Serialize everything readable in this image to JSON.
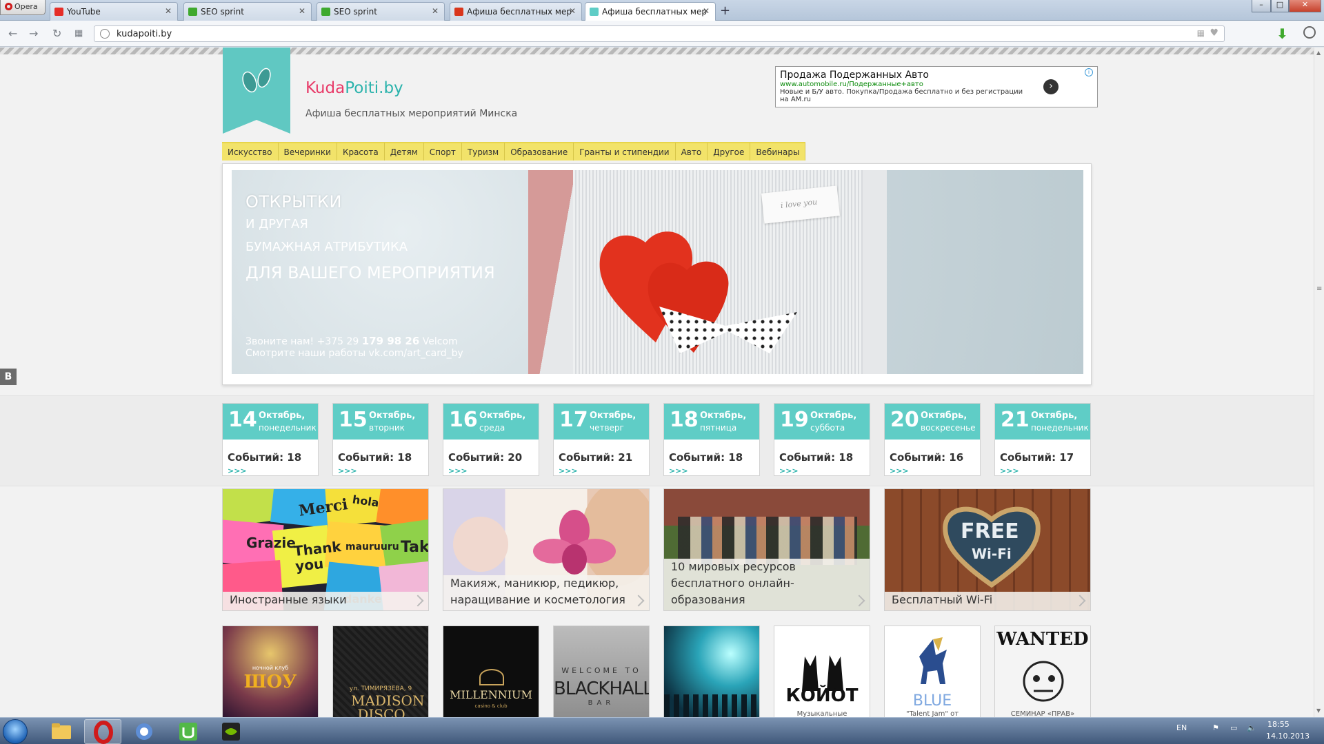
{
  "browser": {
    "menu_label": "Opera",
    "tabs": [
      {
        "title": "YouTube",
        "icon_color": "#e52d27"
      },
      {
        "title": "SEO sprint",
        "icon_color": "#3fa92e"
      },
      {
        "title": "SEO sprint",
        "icon_color": "#3fa92e"
      },
      {
        "title": "Афиша бесплатных мер",
        "icon_color": "#d9361c"
      },
      {
        "title": "Афиша бесплатных мер",
        "icon_color": "#5fcdc6"
      }
    ],
    "new_tab": "+",
    "url": "kudapoiti.by",
    "window_controls": {
      "minimize": "–",
      "maximize": "□",
      "close": "✕"
    }
  },
  "site": {
    "logo_part1": "Kuda",
    "logo_part2": "Poiti.by",
    "tagline": "Афиша бесплатных мероприятий Минска",
    "accent_color": "#5fcdc6",
    "nav_color": "#f2e36a"
  },
  "ad": {
    "title": "Продажа Подержанных Авто",
    "url": "www.automobile.ru/Подержанные+авто",
    "description": "Новые и Б/У авто. Покупка/Продажа бесплатно и без регистрации на AM.ru",
    "info_icon": "i"
  },
  "categories": [
    "Искусство",
    "Вечеринки",
    "Красота",
    "Детям",
    "Спорт",
    "Туризм",
    "Образование",
    "Гранты и стипендии",
    "Авто",
    "Другое",
    "Вебинары"
  ],
  "banner": {
    "line1": "ОТКРЫТКИ",
    "line2": "И ДРУГАЯ",
    "line3": "БУМАЖНАЯ АТРИБУТИКА",
    "line4": "ДЛЯ ВАШЕГО МЕРОПРИЯТИЯ",
    "phone_prefix": "Звоните нам! +375 29",
    "phone_number": "179 98 26",
    "phone_operator": "Velcom",
    "vk_text": "Смотрите наши работы vk.com/art_card_by",
    "tag_text": "i love you"
  },
  "days": [
    {
      "num": "14",
      "month": "Октябрь,",
      "weekday": "понедельник",
      "events": "Событий: 18"
    },
    {
      "num": "15",
      "month": "Октябрь,",
      "weekday": "вторник",
      "events": "Событий: 18"
    },
    {
      "num": "16",
      "month": "Октябрь,",
      "weekday": "среда",
      "events": "Событий: 20"
    },
    {
      "num": "17",
      "month": "Октябрь,",
      "weekday": "четверг",
      "events": "Событий: 21"
    },
    {
      "num": "18",
      "month": "Октябрь,",
      "weekday": "пятница",
      "events": "Событий: 18"
    },
    {
      "num": "19",
      "month": "Октябрь,",
      "weekday": "суббота",
      "events": "Событий: 18"
    },
    {
      "num": "20",
      "month": "Октябрь,",
      "weekday": "воскресенье",
      "events": "Событий: 16"
    },
    {
      "num": "21",
      "month": "Октябрь,",
      "weekday": "понедельник",
      "events": "Событий: 17"
    }
  ],
  "more_arrows": ">>>",
  "featured": [
    {
      "caption": "Иностранные языки"
    },
    {
      "caption": "Макияж, маникюр, педикюр, наращивание и косметология"
    },
    {
      "caption": "10 мировых ресурсов бесплатного онлайн-образования"
    },
    {
      "caption": "Бесплатный Wi-Fi"
    }
  ],
  "featured_art": {
    "notes": [
      "Merci",
      "Grazie",
      "Thank you",
      "mauruuru",
      "Takk",
      "danke",
      "hola"
    ],
    "wifi_free": "FREE",
    "wifi_wifi": "Wi-Fi"
  },
  "clubs": [
    {
      "line1": "ночной клуб",
      "line2": "ШОУ"
    },
    {
      "line1": "ул. ТИМИРЯЗЕВА, 9",
      "line2": "MADISON DISCO"
    },
    {
      "line1": "MILLENNIUM",
      "line2": "casino & club"
    },
    {
      "line1": "WELCOME TO",
      "line2": "BLACKHALL",
      "line3": "BAR"
    },
    {
      "line1": ""
    },
    {
      "line1": "КОЙОТ",
      "line2": "Музыкальные"
    },
    {
      "line1": "BLUE",
      "line2": "\"Talent Jam\" от"
    },
    {
      "line1": "WANTED",
      "line2": "СЕМИНАР «ПРАВ»"
    }
  ],
  "side_badge": "B",
  "taskbar": {
    "lang": "EN",
    "time": "18:55",
    "date": "14.10.2013"
  }
}
